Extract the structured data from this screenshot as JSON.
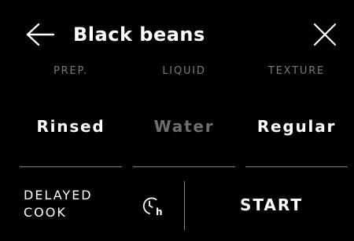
{
  "header": {
    "title": "Black beans",
    "back_icon": "arrow-left-icon",
    "close_icon": "close-icon"
  },
  "options": [
    {
      "label": "PREP.",
      "value": "Rinsed",
      "value_color": "#ffffff"
    },
    {
      "label": "LIQUID",
      "value": "Water",
      "value_color": "#6e6e6e"
    },
    {
      "label": "TEXTURE",
      "value": "Regular",
      "value_color": "#ffffff"
    }
  ],
  "footer": {
    "delayed_line1": "DELAYED",
    "delayed_line2": "COOK",
    "clock_icon": "clock-hours-icon",
    "start_label": "START"
  },
  "colors": {
    "background": "#000000",
    "primary_text": "#ffffff",
    "muted_text": "#7a7a7a",
    "divider": "#7e7e7e"
  }
}
